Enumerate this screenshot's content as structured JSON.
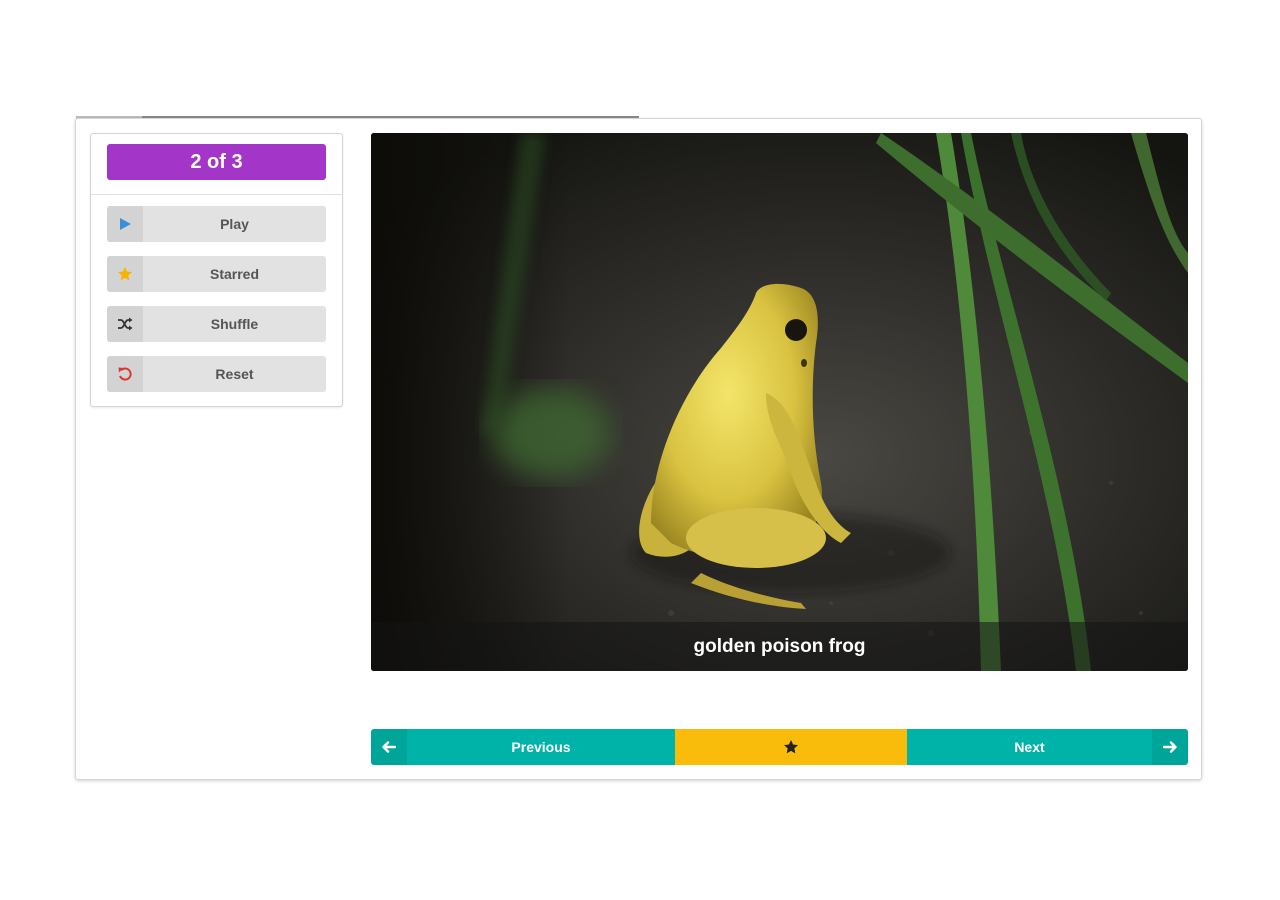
{
  "progress": {
    "fraction": 0.5,
    "color": "#8a8a8a"
  },
  "counter": {
    "text": "2 of 3",
    "color": "#a335c9"
  },
  "sidebar": {
    "buttons": [
      {
        "label": "Play",
        "icon": "play-icon",
        "icon_color": "#3b8fd6"
      },
      {
        "label": "Starred",
        "icon": "star-icon",
        "icon_color": "#f4b400"
      },
      {
        "label": "Shuffle",
        "icon": "shuffle-icon",
        "icon_color": "#333333"
      },
      {
        "label": "Reset",
        "icon": "undo-icon",
        "icon_color": "#d63a2f"
      }
    ]
  },
  "viewer": {
    "caption": "golden poison frog"
  },
  "nav": {
    "previous_label": "Previous",
    "next_label": "Next",
    "teal": "#00b3a8",
    "star_bg": "#f9bc0b",
    "star_color": "#222222"
  }
}
